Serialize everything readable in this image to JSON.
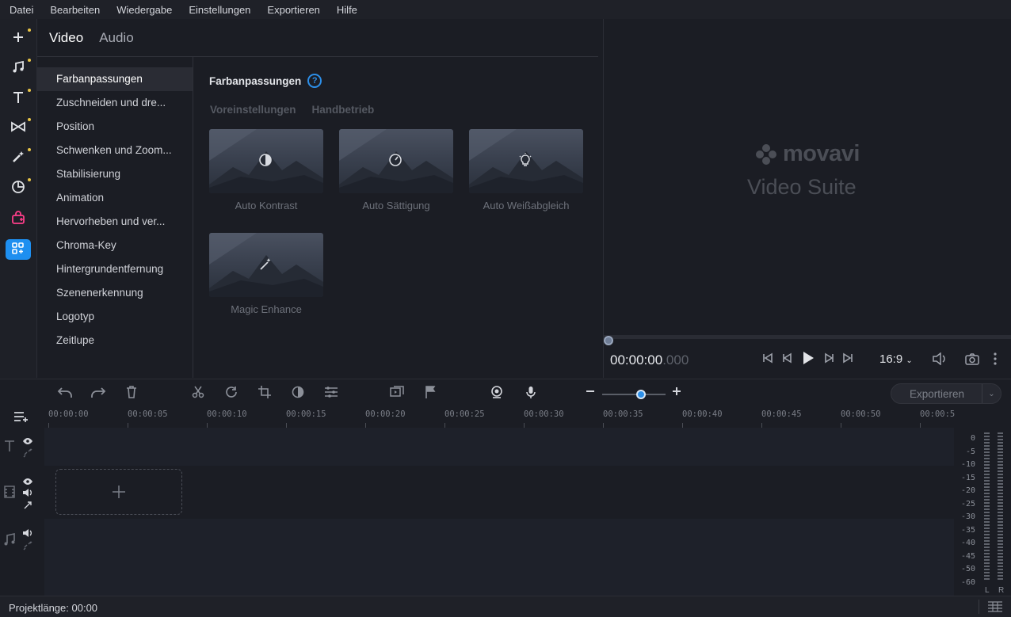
{
  "menu": [
    "Datei",
    "Bearbeiten",
    "Wiedergabe",
    "Einstellungen",
    "Exportieren",
    "Hilfe"
  ],
  "left_tools": [
    {
      "icon": "plus-icon",
      "dot": true
    },
    {
      "icon": "music-icon",
      "dot": true
    },
    {
      "icon": "text-icon",
      "dot": true
    },
    {
      "icon": "transition-icon",
      "dot": true
    },
    {
      "icon": "magic-wand-icon",
      "dot": true
    },
    {
      "icon": "sticker-icon",
      "dot": true
    },
    {
      "icon": "gift-bag-icon",
      "dot": false
    },
    {
      "icon": "more-tools-icon",
      "dot": false,
      "active": true
    }
  ],
  "panel": {
    "tab_video": "Video",
    "tab_audio": "Audio",
    "categories": [
      "Farbanpassungen",
      "Zuschneiden und dre...",
      "Position",
      "Schwenken und Zoom...",
      "Stabilisierung",
      "Animation",
      "Hervorheben und ver...",
      "Chroma-Key",
      "Hintergrundentfernung",
      "Szenenerkennung",
      "Logotyp",
      "Zeitlupe"
    ],
    "selected_category": "Farbanpassungen",
    "content_title": "Farbanpassungen",
    "help_glyph": "?",
    "subtab_presets": "Voreinstellungen",
    "subtab_manual": "Handbetrieb",
    "presets": [
      {
        "label": "Auto Kontrast",
        "icon": "contrast-icon"
      },
      {
        "label": "Auto Sättigung",
        "icon": "saturation-icon"
      },
      {
        "label": "Auto Weißabgleich",
        "icon": "lightbulb-icon"
      },
      {
        "label": "Magic Enhance",
        "icon": "magic-wand-icon"
      }
    ]
  },
  "preview": {
    "logo_word": "movavi",
    "logo_sub": "Video Suite",
    "time_main": "00:00:00",
    "time_ms": ".000",
    "aspect_ratio": "16:9",
    "playback_progress": 0
  },
  "timeline_toolbar": {
    "export_label": "Exportieren",
    "zoom_level": 0.6
  },
  "ruler_ticks": [
    "00:00:00",
    "00:00:05",
    "00:00:10",
    "00:00:15",
    "00:00:20",
    "00:00:25",
    "00:00:30",
    "00:00:35",
    "00:00:40",
    "00:00:45",
    "00:00:50",
    "00:00:5"
  ],
  "meter": {
    "labels": [
      "0",
      "-5",
      "-10",
      "-15",
      "-20",
      "-25",
      "-30",
      "-35",
      "-40",
      "-45",
      "-50",
      "-60"
    ],
    "left": "L",
    "right": "R"
  },
  "status": {
    "project_length": "Projektlänge: 00:00"
  },
  "colors": {
    "accent": "#1e8ff0",
    "background": "#1b1d24",
    "dot": "#e9c547"
  }
}
